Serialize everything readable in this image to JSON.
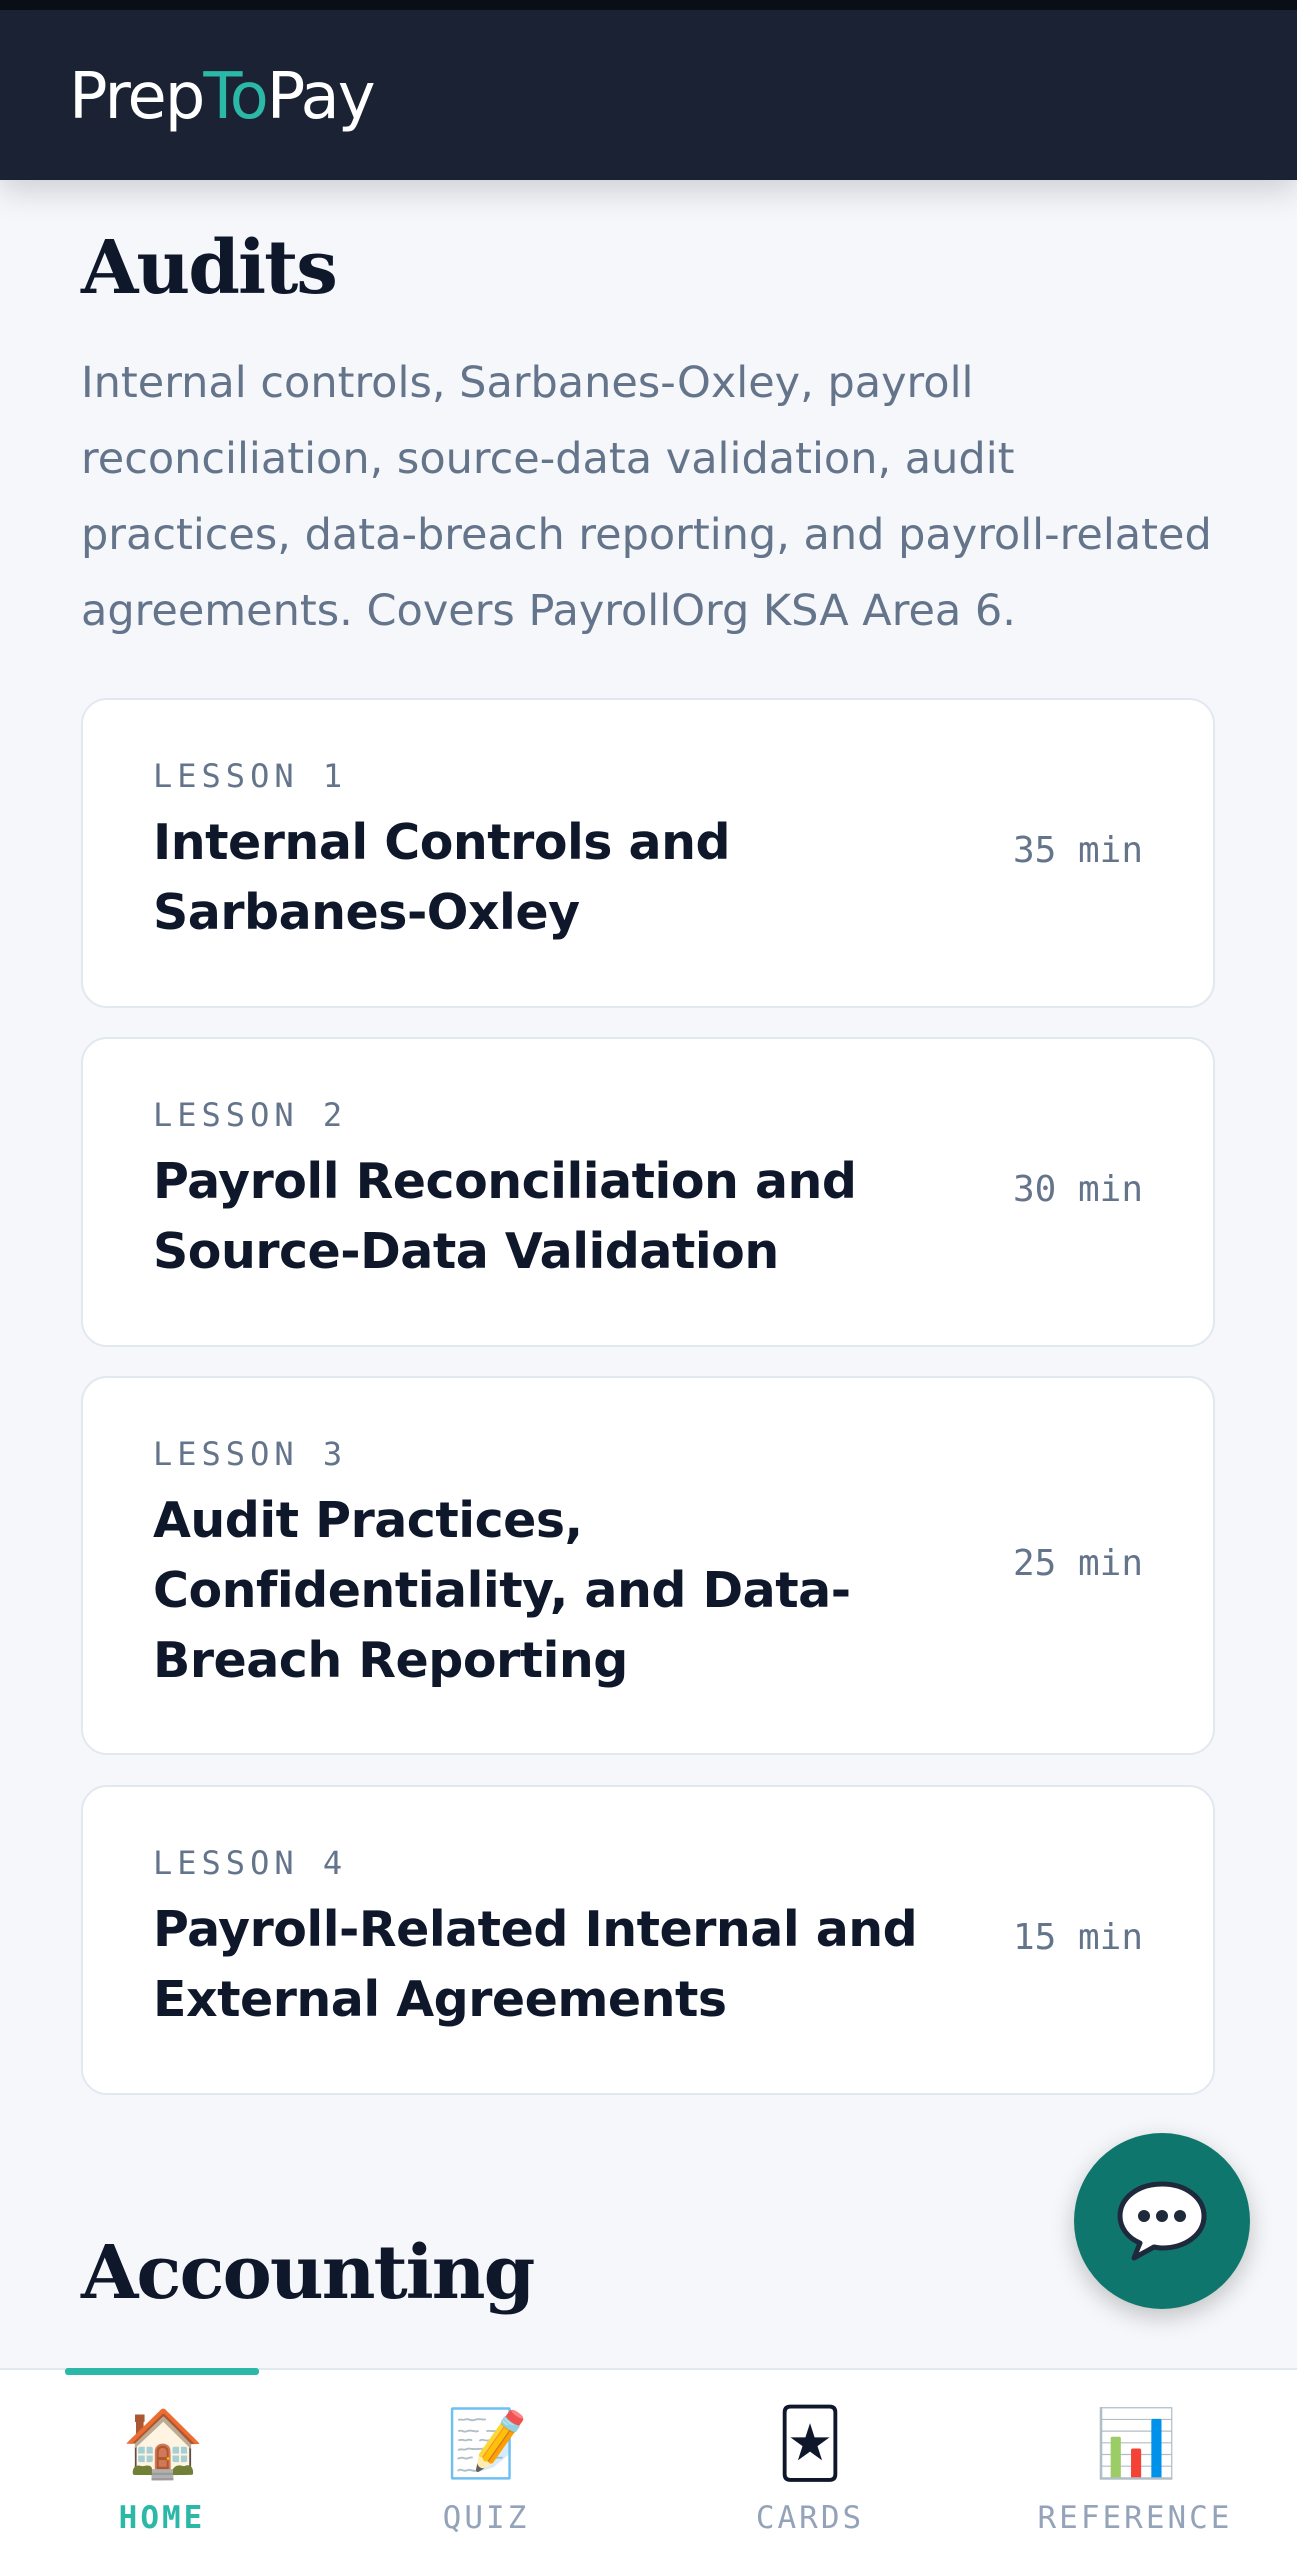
{
  "app": {
    "logo_prefix": "Prep",
    "logo_accent": "To",
    "logo_suffix": "Pay",
    "accent_color": "#2bb8a6",
    "header_color": "#1a2233"
  },
  "sections": [
    {
      "title": "Audits",
      "description": "Internal controls, Sarbanes-Oxley, payroll reconciliation, source-data validation, audit practices, data-breach reporting, and payroll-related agreements. Covers PayrollOrg KSA Area 6.",
      "lessons": [
        {
          "number": "LESSON 1",
          "title": "Internal Controls and Sarbanes-Oxley",
          "duration": "35 min"
        },
        {
          "number": "LESSON 2",
          "title": "Payroll Reconciliation and Source-Data Validation",
          "duration": "30 min"
        },
        {
          "number": "LESSON 3",
          "title": "Audit Practices, Confidentiality, and Data-Breach Reporting",
          "duration": "25 min"
        },
        {
          "number": "LESSON 4",
          "title": "Payroll-Related Internal and External Agreements",
          "duration": "15 min"
        }
      ]
    },
    {
      "title": "Accounting"
    }
  ],
  "chat_button": {
    "icon": "speech-bubble-icon"
  },
  "tabs": [
    {
      "label": "HOME",
      "icon": "🏠",
      "active": true
    },
    {
      "label": "QUIZ",
      "icon": "📝",
      "active": false
    },
    {
      "label": "CARDS",
      "icon": "🃏",
      "active": false
    },
    {
      "label": "REFERENCE",
      "icon": "📊",
      "active": false
    }
  ]
}
